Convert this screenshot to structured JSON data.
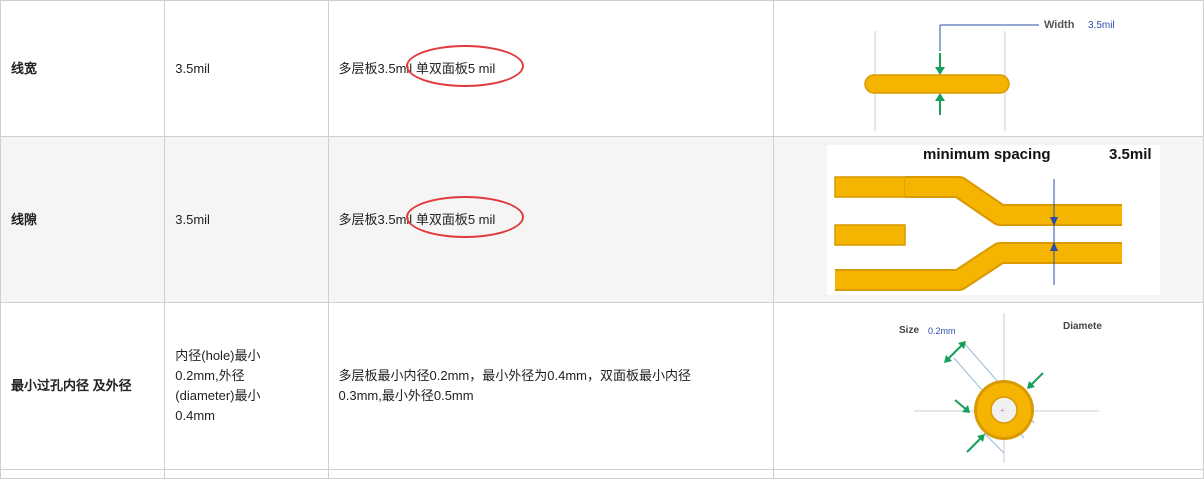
{
  "rows": [
    {
      "name": "线宽",
      "value": "3.5mil",
      "note_main": "多层板3.5mil",
      "note_circled": "单双面板5 mil",
      "diagram": {
        "label": "Width",
        "value": "3.5mil"
      }
    },
    {
      "name": "线隙",
      "value": "3.5mil",
      "note_main": "多层板3.5mil",
      "note_circled": "单双面板5 mil",
      "diagram": {
        "label": "minimum spacing",
        "value": "3.5mil"
      }
    },
    {
      "name": "最小过孔内径 及外径",
      "value_lines": [
        "内径(hole)最小",
        "0.2mm,外径",
        "(diameter)最小",
        "0.4mm"
      ],
      "note_lines": [
        "多层板最小内径0.2mm，最小外径为0.4mm，双面板最小内径",
        "0.3mm,最小外径0.5mm"
      ],
      "diagram": {
        "size_label": "Size",
        "size_value": "0.2mm",
        "diameter_label": "Diamete"
      }
    }
  ],
  "colors": {
    "trace": "#f5b400",
    "trace_edge": "#d89a00",
    "arrow": "#14a05a",
    "circle": "#e23a3a",
    "grid": "#cccccc"
  }
}
